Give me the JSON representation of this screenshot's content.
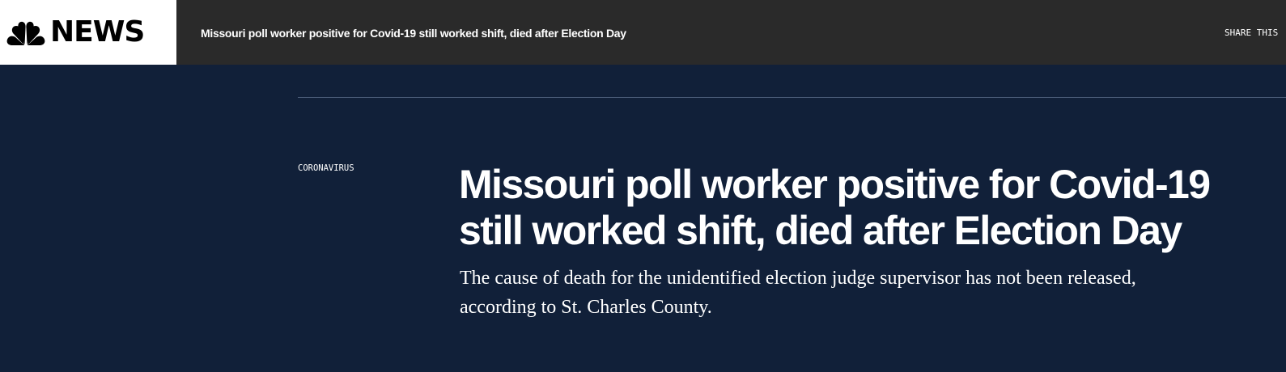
{
  "header": {
    "logo_text": "NEWS",
    "logo_icon": "peacock-icon",
    "article_title": "Missouri poll worker positive for Covid-19 still worked shift, died after Election Day",
    "share_label": "SHARE THIS"
  },
  "article": {
    "category": "CORONAVIRUS",
    "headline": "Missouri poll worker positive for Covid-19 still worked shift, died after Election Day",
    "dek": "The cause of death for the unidentified election judge supervisor has not been released, according to St. Charles County."
  },
  "colors": {
    "topbar_bg": "#2a2a2a",
    "page_bg": "#112039",
    "divider": "#4b5c78",
    "text": "#ffffff",
    "peacock": [
      "#000000"
    ]
  }
}
